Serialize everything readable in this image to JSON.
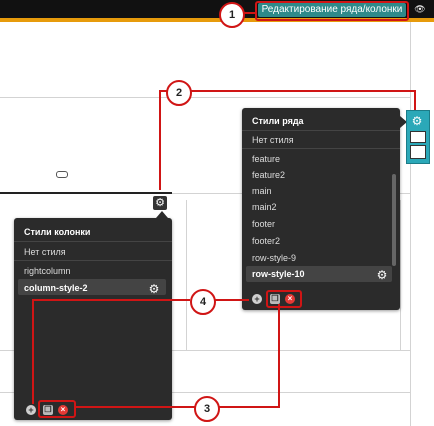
{
  "toolbar": {
    "edit_button_label": "Редактирование ряда/колонки",
    "accent_color": "#e79b0c",
    "button_color": "#2e8a8a"
  },
  "column_styles_panel": {
    "title": "Стили колонки",
    "no_style": "Нет стиля",
    "items": [
      "rightcolumn",
      "column-style-2"
    ],
    "selected": "column-style-2"
  },
  "row_styles_panel": {
    "title": "Стили ряда",
    "no_style": "Нет стиля",
    "items": [
      "feature",
      "feature2",
      "main",
      "main2",
      "footer",
      "footer2",
      "row-style-9",
      "row-style-10"
    ],
    "selected": "row-style-10"
  },
  "callouts": [
    "1",
    "2",
    "3",
    "4"
  ],
  "icons": {
    "gear": "⚙",
    "eye": "👁",
    "plus": "+",
    "copy": "❐",
    "delete": "×"
  }
}
